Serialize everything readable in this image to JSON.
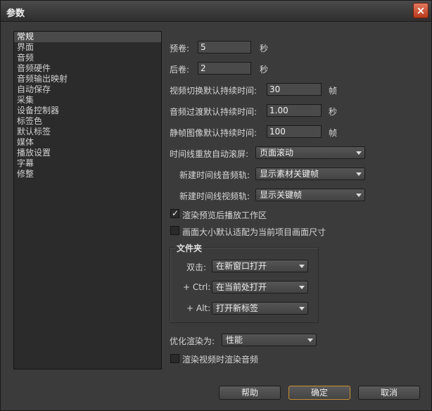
{
  "window": {
    "title": "参数",
    "close": "×"
  },
  "sidebar": {
    "items": [
      {
        "label": "常规",
        "selected": true
      },
      {
        "label": "界面"
      },
      {
        "label": "音频"
      },
      {
        "label": "音频硬件"
      },
      {
        "label": "音频输出映射"
      },
      {
        "label": "自动保存"
      },
      {
        "label": "采集"
      },
      {
        "label": "设备控制器"
      },
      {
        "label": "标签色"
      },
      {
        "label": "默认标签"
      },
      {
        "label": "媒体"
      },
      {
        "label": "播放设置"
      },
      {
        "label": "字幕"
      },
      {
        "label": "修整"
      }
    ]
  },
  "general": {
    "preroll_label": "预卷:",
    "preroll_value": "5",
    "preroll_unit": "秒",
    "postroll_label": "后卷:",
    "postroll_value": "2",
    "postroll_unit": "秒",
    "video_transition_label": "视频切换默认持续时间:",
    "video_transition_value": "30",
    "video_transition_unit": "帧",
    "audio_transition_label": "音频过渡默认持续时间:",
    "audio_transition_value": "1.00",
    "audio_transition_unit": "秒",
    "still_label": "静帧图像默认持续时间:",
    "still_value": "100",
    "still_unit": "帧",
    "timeline_scroll_label": "时间线重放自动滚屏:",
    "timeline_scroll_value": "页面滚动",
    "new_audio_track_label": "新建时间线音频轨:",
    "new_audio_track_value": "显示素材关键帧",
    "new_video_track_label": "新建时间线视频轨:",
    "new_video_track_value": "显示关键帧",
    "play_after_render_label": "渲染预览后播放工作区",
    "play_after_render_checked": true,
    "scale_to_frame_label": "画面大小默认适配为当前项目画面尺寸",
    "scale_to_frame_checked": false,
    "bins": {
      "title": "文件夹",
      "double_click_label": "双击:",
      "double_click_value": "在新窗口打开",
      "ctrl_label": "+ Ctrl:",
      "ctrl_value": "在当前处打开",
      "alt_label": "+ Alt:",
      "alt_value": "打开新标签"
    },
    "optimize_label": "优化渲染为:",
    "optimize_value": "性能",
    "render_audio_label": "渲染视频时渲染音频",
    "render_audio_checked": false
  },
  "buttons": {
    "help": "帮助",
    "ok": "确定",
    "cancel": "取消"
  },
  "colors": {
    "panel": "#3b3b3b",
    "focus_border": "#c89033"
  }
}
